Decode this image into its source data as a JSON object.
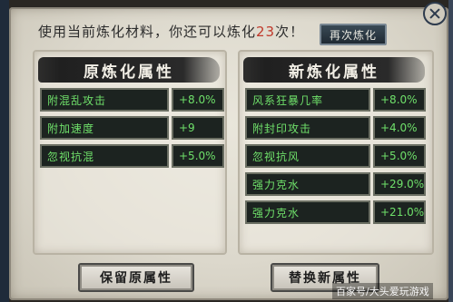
{
  "hint": {
    "prefix": "使用当前炼化材料，你还可以炼化",
    "count": "23",
    "suffix": "次！"
  },
  "again_button": "再次炼化",
  "original": {
    "title": "原炼化属性",
    "rows": [
      {
        "name": "附混乱攻击",
        "value": "+8.0%"
      },
      {
        "name": "附加速度",
        "value": "+9"
      },
      {
        "name": "忽视抗混",
        "value": "+5.0%"
      }
    ]
  },
  "new": {
    "title": "新炼化属性",
    "rows": [
      {
        "name": "风系狂暴几率",
        "value": "+8.0%"
      },
      {
        "name": "附封印攻击",
        "value": "+4.0%"
      },
      {
        "name": "忽视抗风",
        "value": "+5.0%"
      },
      {
        "name": "强力克水",
        "value": "+29.0%"
      },
      {
        "name": "强力克水",
        "value": "+21.0%"
      }
    ]
  },
  "buttons": {
    "keep": "保留原属性",
    "replace": "替换新属性"
  },
  "watermark": "百家号/大头爱玩游戏"
}
